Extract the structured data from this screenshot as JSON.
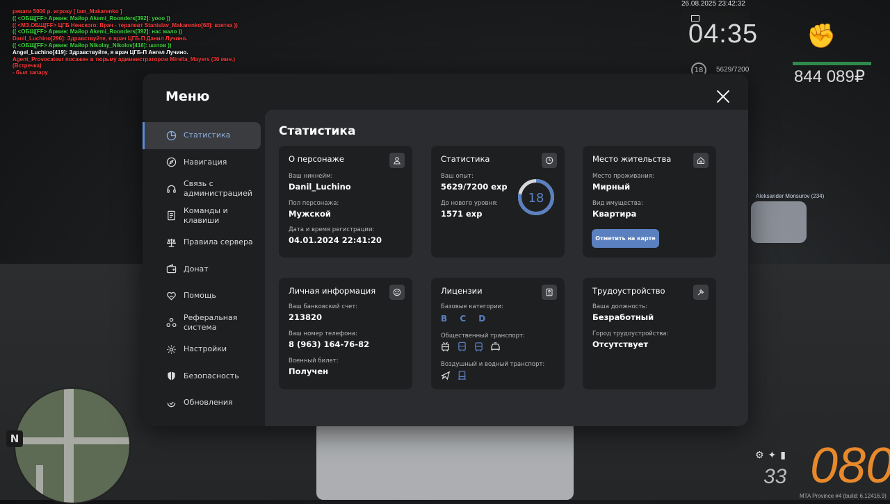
{
  "chat": [
    {
      "text": "ревати 5000 р. игроку [ iam_Makarenko ]",
      "color": "#ff3a3a"
    },
    {
      "text": "(( <ОБЩ[FF> Армин: Майор Akemi_Roonders[392]: уооо ))",
      "color": "#3dd43d"
    },
    {
      "text": "(( <МЗ.ОБЩ[FF> ЦГБ Ненского: Врач - терапевт Stanislav_Makarenko[68]: взятка ))",
      "color": "#ff3a3a"
    },
    {
      "text": "(( <ОБЩ[FF> Армин: Майор Akemi_Roonders[392]: нас мало ))",
      "color": "#3dd43d"
    },
    {
      "text": "Danil_Luchino[296]: Здравствуйте, я врач ЦГБ-П Данил Лучино.",
      "color": "#ff3a3a"
    },
    {
      "text": "(( <ОБЩ[FF> Армин: Майор Nikolay_Nikolov[416]: шатов ))",
      "color": "#3dd43d"
    },
    {
      "text": "Angel_Luchino[419]: Здравствуйте, я врач ЦГБ-П Ангел Лучино.",
      "color": "#ffffff"
    },
    {
      "text": "Agent_Provocateur посажен в тюрьму администратором Mirella_Mayers (30 мин.)",
      "color": "#ff3a3a"
    },
    {
      "text": "(Встречка)",
      "color": "#ff3a3a"
    },
    {
      "text": "- был запару",
      "color": "#ff3a3a"
    }
  ],
  "hud": {
    "datetime": "26.08.2025 23:42:32",
    "time": "04:35",
    "level": "18",
    "exp": "5629/7200",
    "money": "844 089₽",
    "fist_icon": "fist-icon"
  },
  "nick_tag": "Aleksander Monsurov (234)",
  "minimap_north": "N",
  "speedo": {
    "gear": "33",
    "speed": "080",
    "build": "MTA Province #4 (build: 6.12416.9)"
  },
  "menu": {
    "title": "Меню",
    "sidebar": [
      {
        "label": "Статистика",
        "icon": "pie-chart-icon"
      },
      {
        "label": "Навигация",
        "icon": "compass-icon"
      },
      {
        "label": "Связь с администрацией",
        "icon": "headset-icon"
      },
      {
        "label": "Команды и клавиши",
        "icon": "document-icon"
      },
      {
        "label": "Правила сервера",
        "icon": "scales-icon"
      },
      {
        "label": "Донат",
        "icon": "wallet-icon"
      },
      {
        "label": "Помощь",
        "icon": "heart-hands-icon"
      },
      {
        "label": "Реферальная система",
        "icon": "referral-icon"
      },
      {
        "label": "Настройки",
        "icon": "gear-icon"
      },
      {
        "label": "Безопасность",
        "icon": "shield-icon"
      },
      {
        "label": "Обновления",
        "icon": "refresh-check-icon"
      }
    ],
    "content_title": "Статистика",
    "character": {
      "title": "О персонаже",
      "nick_label": "Ваш никнейм:",
      "nick": "Danil_Luchino",
      "gender_label": "Пол персонажа:",
      "gender": "Мужской",
      "reg_label": "Дата и время регистрации:",
      "reg": "04.01.2024 22:41:20"
    },
    "stats": {
      "title": "Статистика",
      "exp_label": "Ваш опыт:",
      "exp": "5629/7200 exp",
      "next_label": "До нового уровня:",
      "next": "1571 exp",
      "level": "18",
      "progress": 0.78
    },
    "residence": {
      "title": "Место жительства",
      "place_label": "Место проживания:",
      "place": "Мирный",
      "type_label": "Вид имущества:",
      "type": "Квартира",
      "button": "Отметить на карте"
    },
    "personal": {
      "title": "Личная информация",
      "bank_label": "Ваш банковский счет:",
      "bank": "213820",
      "phone_label": "Ваш номер телефона:",
      "phone": "8 (963) 164-76-82",
      "military_label": "Военный билет:",
      "military": "Получен"
    },
    "licenses": {
      "title": "Лицензии",
      "base_label": "Базовые категории:",
      "base": "B C D",
      "public_label": "Общественный транспорт:",
      "air_label": "Воздушный и водный транспорт:"
    },
    "employment": {
      "title": "Трудоустройство",
      "position_label": "Ваша должность:",
      "position": "Безработный",
      "city_label": "Город трудоустройства:",
      "city": "Отсутствует"
    },
    "accent": "#5b80c0"
  }
}
